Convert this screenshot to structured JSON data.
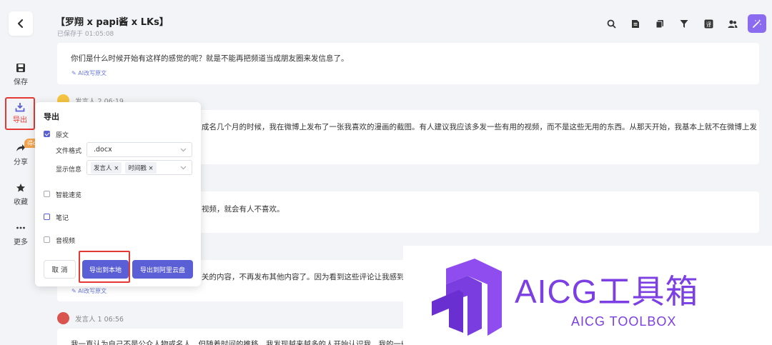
{
  "header": {
    "title": "【罗翔 x papi酱 x LKs】",
    "saved_at": "已保存于 01:05:08"
  },
  "sidebar": {
    "save": "保存",
    "export": "导出",
    "share": "分享",
    "share_badge": "得d",
    "favorite": "收藏",
    "more": "更多"
  },
  "toolbar": {
    "icons": [
      "search-icon",
      "document-icon",
      "copy-icon",
      "filter-icon",
      "translate-icon",
      "users-icon",
      "magic-wand-icon"
    ]
  },
  "transcript": {
    "card1_text": "你们是什么时候开始有这样的感觉的呢？就是不能再把频道当成朋友圈来发信息了。",
    "ai_rewrite": "AI改写原文",
    "speaker2_label": "发言人 2  06:19",
    "card2_text": "成名几个月的时候，我在微博上发布了一张我喜欢的漫画的截图。有人建议我应该多发一些有用的视频，而不是这些无用的东西。从那天开始，我基本上就不在微博上发",
    "card3_text": "视频，就会有人不喜欢。",
    "card4_text": "关的内容，不再发布其他内容了。因为看到这些评论让我感到很",
    "card4_ai": "AI改写原文",
    "speaker1_label": "发言人 1  06:56",
    "card5_text": "我一直认为自己不是公众人物或名人，但随着时间的推移，我发现越来越多的人开始认识我，我的一些朋"
  },
  "export_panel": {
    "title": "导出",
    "original_label": "原文",
    "format_label": "文件格式",
    "format_value": ".docx",
    "display_label": "显示信息",
    "tag_speaker": "发言人 ×",
    "tag_timestamp": "时间戳 ×",
    "smart_summary": "智能速览",
    "notes": "笔记",
    "audio_video": "音视频",
    "cancel": "取 消",
    "export_local": "导出到本地",
    "export_cloud": "导出到阿里云盘"
  },
  "watermark": {
    "title": "AICG工具箱",
    "subtitle": "AICG TOOLBOX"
  },
  "colors": {
    "accent": "#5b5fd6",
    "highlight": "#e53935",
    "brand": "#7b3fe4"
  }
}
